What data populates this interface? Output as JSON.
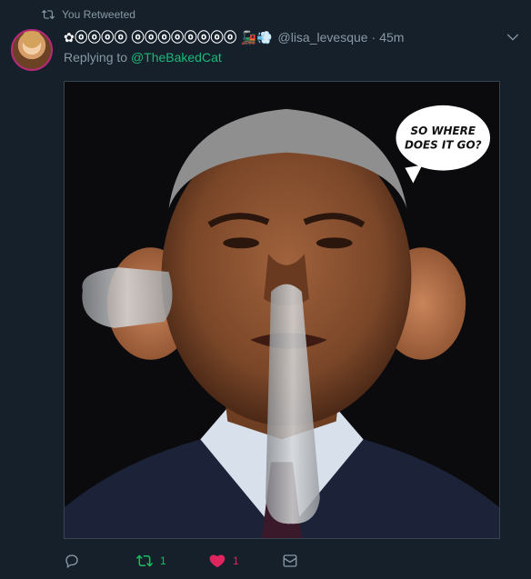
{
  "context": {
    "icon": "retweet-icon",
    "text": "You Retweeted"
  },
  "tweet": {
    "display_name": "✿ⓞⓞⓞⓞ ⓞⓞⓞⓞⓞⓞⓞⓞ",
    "name_emoji": "🚂💨",
    "handle": "@lisa_levesque",
    "separator": "·",
    "time": "45m",
    "replying_prefix": "Replying to",
    "replying_to": "@TheBakedCat",
    "image_bubble_line1": "SO WHERE",
    "image_bubble_line2": "DOES IT GO?"
  },
  "actions": {
    "reply": {
      "icon": "reply-icon",
      "count": ""
    },
    "retweet": {
      "icon": "retweet-icon",
      "count": "1",
      "active": true,
      "color": "#17bf63"
    },
    "like": {
      "icon": "heart-icon",
      "count": "1",
      "active": true,
      "color": "#e0245e"
    },
    "dm": {
      "icon": "envelope-icon",
      "count": ""
    }
  },
  "colors": {
    "background": "#15202b",
    "secondary_text": "#8899a6",
    "mention": "#1bb97a"
  }
}
